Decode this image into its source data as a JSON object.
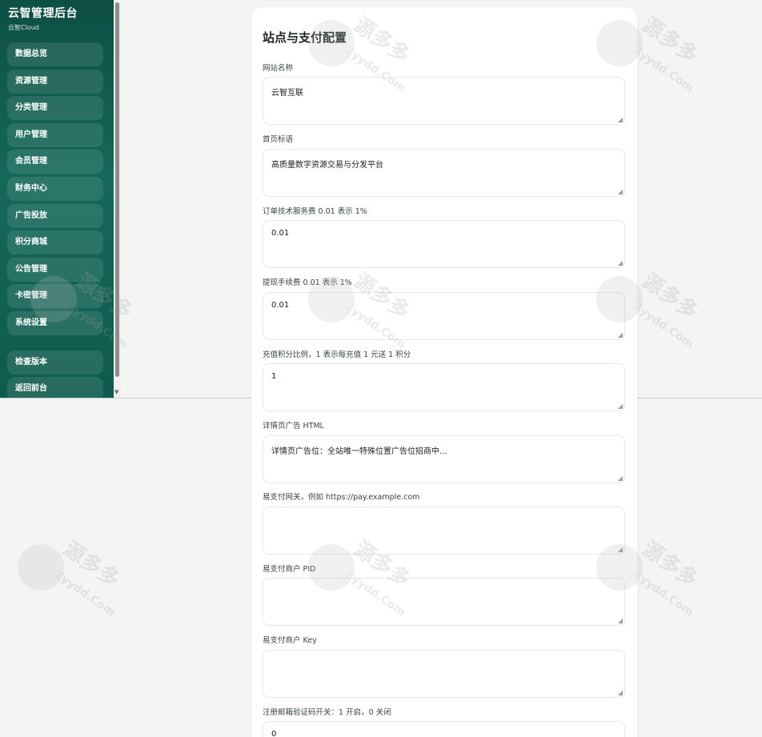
{
  "brand": {
    "title": "云智管理后台",
    "subtitle": "云智Cloud"
  },
  "sidebar": {
    "items": [
      {
        "label": "数据总览"
      },
      {
        "label": "资源管理"
      },
      {
        "label": "分类管理"
      },
      {
        "label": "用户管理"
      },
      {
        "label": "会员管理"
      },
      {
        "label": "财务中心"
      },
      {
        "label": "广告投放"
      },
      {
        "label": "积分商城"
      },
      {
        "label": "公告管理"
      },
      {
        "label": "卡密管理"
      },
      {
        "label": "系统设置"
      }
    ],
    "bottom_items": [
      {
        "label": "检查版本"
      },
      {
        "label": "返回前台"
      }
    ]
  },
  "form": {
    "title": "站点与支付配置",
    "fields": [
      {
        "label": "网站名称",
        "value": "云智互联"
      },
      {
        "label": "首页标语",
        "value": "高质量数字资源交易与分发平台"
      },
      {
        "label": "订单技术服务费 0.01 表示 1%",
        "value": "0.01"
      },
      {
        "label": "提现手续费 0.01 表示 1%",
        "value": "0.01"
      },
      {
        "label": "充值积分比例，1 表示每充值 1 元送 1 积分",
        "value": "1"
      },
      {
        "label": "详情页广告 HTML",
        "value": "详情页广告位：全站唯一特殊位置广告位招商中..."
      },
      {
        "label": "易支付网关，例如 https://pay.example.com",
        "value": ""
      },
      {
        "label": "易支付商户 PID",
        "value": ""
      },
      {
        "label": "易支付商户 Key",
        "value": ""
      },
      {
        "label": "注册邮箱验证码开关：1 开启，0 关闭",
        "value": "0"
      }
    ]
  },
  "watermark": {
    "text": "源多多",
    "domain": "Zyydd.Com"
  },
  "colors": {
    "sidebar": "#16685a",
    "page_bg": "#f3f5f4",
    "card_bg": "#ffffff"
  }
}
